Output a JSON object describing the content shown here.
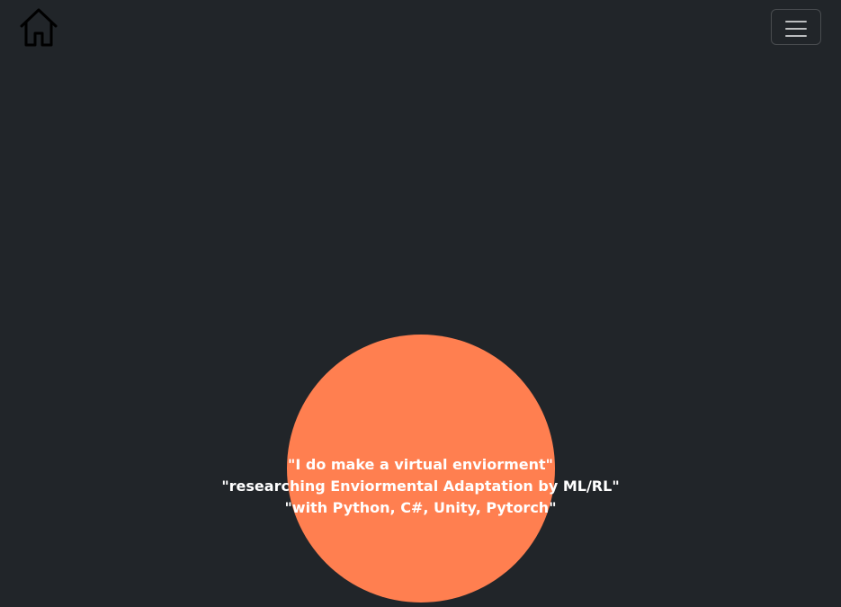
{
  "nav": {
    "home_icon": "house-icon",
    "menu_icon": "hamburger-menu-icon"
  },
  "hero": {
    "accent_color": "#ff7f50",
    "background_color": "#212529",
    "lines": [
      "\"I do make a virtual enviorment\"",
      "\"researching Enviormental Adaptation by ML/RL\"",
      "\"with Python, C#, Unity, Pytorch\""
    ]
  }
}
